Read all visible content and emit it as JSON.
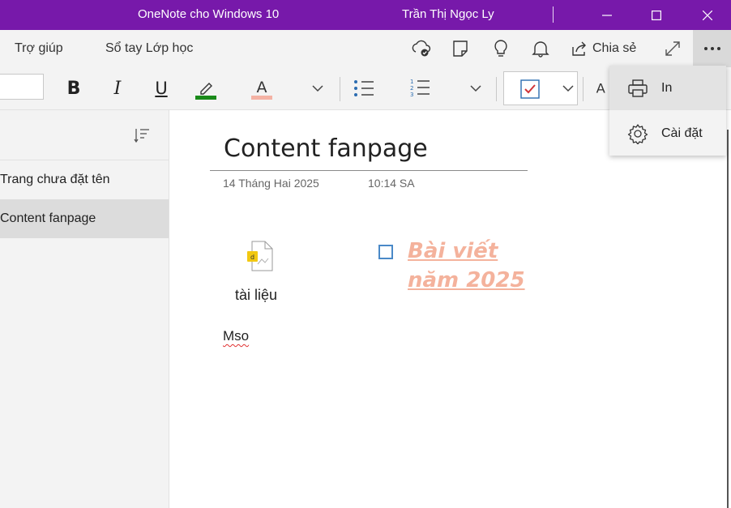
{
  "window": {
    "title": "OneNote cho Windows 10",
    "user": "Trần Thị Ngọc Ly"
  },
  "menu": {
    "help": "Trợ giúp",
    "class_notebook": "Sổ tay Lớp học",
    "share": "Chia sẻ"
  },
  "ribbon": {
    "bold": "B",
    "italic": "I",
    "underline": "U",
    "font_color_glyph": "A",
    "style_glyph": "A",
    "highlight_color": "#1a8a1a",
    "font_color": "#f4b2a4",
    "todo_check_color": "#d13438"
  },
  "pages": [
    {
      "label": "Trang chưa đặt tên",
      "selected": false
    },
    {
      "label": "Content fanpage",
      "selected": true
    }
  ],
  "page": {
    "title": "Content fanpage",
    "date": "14 Tháng Hai 2025",
    "time": "10:14 SA",
    "attachment_label": "tài liệu",
    "text": "Mso",
    "todo_text": "Bài viết năm 2025",
    "todo_color": "#f4b29c"
  },
  "more_menu": {
    "print": "In",
    "settings": "Cài đặt"
  },
  "icons": [
    "sync-icon",
    "page-icon",
    "lightbulb-icon",
    "bell-icon",
    "share-icon",
    "fullscreen-icon",
    "more-icon",
    "print-icon",
    "gear-icon",
    "sort-icon",
    "file-icon",
    "bullets-icon",
    "numbering-icon",
    "checkbox-tag-icon",
    "chevron-down-icon"
  ],
  "accent_color": "#7719aa"
}
